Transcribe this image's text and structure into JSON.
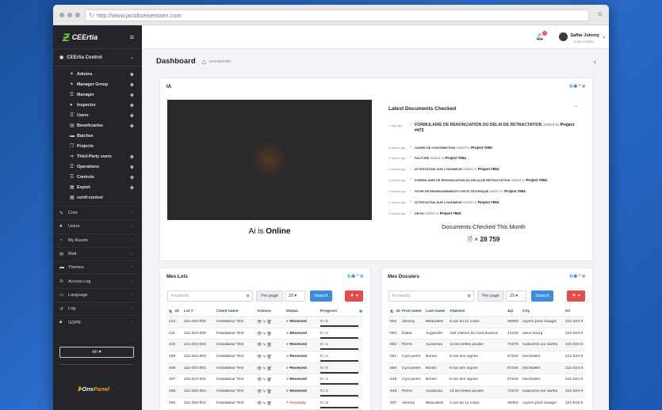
{
  "browser": {
    "url": "http://www.jacobsewensten.com"
  },
  "sidebar": {
    "brand": "CEErtia",
    "section": "CEErtia Control",
    "sub_items": [
      {
        "label": "Admins",
        "icon": "user-shield-icon",
        "plus": true
      },
      {
        "label": "Manager Group",
        "icon": "users-icon",
        "plus": true
      },
      {
        "label": "Manager",
        "icon": "list-icon",
        "plus": true
      },
      {
        "label": "Inspector",
        "icon": "user-icon",
        "plus": true
      },
      {
        "label": "Users",
        "icon": "list-icon",
        "plus": true
      },
      {
        "label": "Beneficiaries",
        "icon": "id-card-icon",
        "plus": true
      },
      {
        "label": "Batches",
        "icon": "folder-icon",
        "plus": false
      },
      {
        "label": "Projects",
        "icon": "copy-icon",
        "plus": false
      },
      {
        "label": "Third-Party users",
        "icon": "arrow-right-icon",
        "plus": true
      },
      {
        "label": "Operations",
        "icon": "list-icon",
        "plus": true
      },
      {
        "label": "Controls",
        "icon": "list-icon",
        "plus": true
      },
      {
        "label": "Export",
        "icon": "calendar-icon",
        "plus": true
      },
      {
        "label": "certif-control",
        "icon": "grid-icon",
        "plus": false
      }
    ],
    "nav": [
      {
        "label": "Core",
        "icon": "wrench-icon"
      },
      {
        "label": "Users",
        "icon": "users-icon"
      },
      {
        "label": "My Assets",
        "icon": "chart-icon"
      },
      {
        "label": "Mail",
        "icon": "mail-icon"
      },
      {
        "label": "Themes",
        "icon": "themes-icon"
      },
      {
        "label": "Access Log",
        "icon": "refresh-icon"
      },
      {
        "label": "Language",
        "icon": "language-icon"
      },
      {
        "label": "Log",
        "icon": "log-icon"
      },
      {
        "label": "GDPR",
        "icon": "lock-icon"
      }
    ],
    "language": "en",
    "footer_brand_prefix": "Ons",
    "footer_brand_suffix": "Panel"
  },
  "topbar": {
    "user_name": "Saffar Johnny",
    "user_role": "Super Admin",
    "notif_count": "1"
  },
  "page": {
    "title": "Dashboard",
    "breadcrumb": "DASHBOARD"
  },
  "ia_card": {
    "title": "IA",
    "status_prefix": "Ai",
    "status_suffix": " is ",
    "status_word": "Online",
    "latest_title": "Latest Documents Checked",
    "timeline": [
      {
        "time": "1 day ago",
        "doc": "FORMULAIRE DE RENONCIATION DU DELAI DE RETRACTATION",
        "mid": " added to ",
        "project": "Project #472"
      },
      {
        "time": "2 weeks ago",
        "doc": "CADRE DE CONTRIBUTION",
        "mid": " added to ",
        "project": "Project #554"
      },
      {
        "time": "2 weeks ago",
        "doc": "FACTURE",
        "mid": " added to ",
        "project": "Project #554"
      },
      {
        "time": "2 weeks ago",
        "doc": "ATTESTATION SUR L'HONNEUR",
        "mid": " added to ",
        "project": "Project #554"
      },
      {
        "time": "2 weeks ago",
        "doc": "FORMULAIRE DE RENONCIATION DU DELAI DE RETRACTATION",
        "mid": " added to ",
        "project": "Project #554"
      },
      {
        "time": "2 weeks ago",
        "doc": "FICHE DE RENSEIGNEMENTS VISITE TECHNIQUE",
        "mid": " added to ",
        "project": "Project #554"
      },
      {
        "time": "2 weeks ago",
        "doc": "ATTESTATION SUR L'HONNEUR",
        "mid": " added to ",
        "project": "Project #553"
      },
      {
        "time": "2 weeks ago",
        "doc": "DEVIS",
        "mid": " added to ",
        "project": "Project #553"
      }
    ],
    "docs_title": "Documents Checked This Month",
    "docs_value": "28 759",
    "docs_prefix": "× "
  },
  "lots": {
    "title": "Mes Lots",
    "keywords_placeholder": "Keywords",
    "per_page_label": "Per page",
    "per_page_value": "20",
    "search_label": "Search",
    "columns": [
      "ID",
      "Lot #",
      "Client name",
      "Actions",
      "Status",
      "Progress"
    ],
    "rows": [
      {
        "id": "212",
        "lot": "221-024-005",
        "client": "Installateur Test",
        "status": "Received",
        "progress": "0 / 2"
      },
      {
        "id": "211",
        "lot": "221-024-005",
        "client": "Installateur Test",
        "status": "Received",
        "progress": "0 / 1"
      },
      {
        "id": "210",
        "lot": "221-024-004",
        "client": "Installateur Test",
        "status": "Received",
        "progress": "0 / 1"
      },
      {
        "id": "209",
        "lot": "221-024-003",
        "client": "Installateur Test",
        "status": "Received",
        "progress": "0 / 1"
      },
      {
        "id": "208",
        "lot": "221-024-002",
        "client": "Installateur Test",
        "status": "Received",
        "progress": "0 / 0"
      },
      {
        "id": "207",
        "lot": "221-024-001",
        "client": "Installateur Test",
        "status": "Received",
        "progress": "0 / 1"
      },
      {
        "id": "206",
        "lot": "221-020-002",
        "client": "Installateur Test",
        "status": "Received",
        "progress": "0 / 2"
      },
      {
        "id": "205",
        "lot": "221-020-001",
        "client": "Installateur Test",
        "status": "Anomaly",
        "progress": "0 / 3"
      }
    ]
  },
  "dossiers": {
    "title": "Mes Dossiers",
    "keywords_placeholder": "Keywords",
    "per_page_label": "Per page",
    "per_page_value": "20",
    "search_label": "Search",
    "columns": [
      "ID",
      "First name",
      "Last name",
      "Address",
      "Zip",
      "City",
      "lot"
    ],
    "rows": [
      {
        "id": "554",
        "first": "Jeremy",
        "last": "Billaudelle",
        "address": "4 rue du 11 corps",
        "zip": "06350",
        "city": "noyers pont maugis",
        "lot": "221-024-0"
      },
      {
        "id": "553",
        "first": "Didier",
        "last": "Augendre",
        "address": "146 chemin du rond buisson",
        "zip": "14100",
        "city": "vieux bourg",
        "lot": "221-024-0"
      },
      {
        "id": "552",
        "first": "Pierre",
        "last": "Audureau",
        "address": "13 les belles poules",
        "zip": "72270",
        "city": "malicorne sur sarthe",
        "lot": "221-024-0"
      },
      {
        "id": "551",
        "first": "Cyril pierre",
        "last": "Bories",
        "address": "8 rue des vignes",
        "zip": "67240",
        "city": "bischwiller",
        "lot": "221-024-0"
      },
      {
        "id": "550",
        "first": "Cyril pierre",
        "last": "Bories",
        "address": "8 rue des vignes",
        "zip": "67240",
        "city": "bischwiller",
        "lot": "221-024-0"
      },
      {
        "id": "549",
        "first": "Cyril pierre",
        "last": "Bories",
        "address": "8 rue des vignes",
        "zip": "67240",
        "city": "bischwiller",
        "lot": "221-024-0"
      },
      {
        "id": "548",
        "first": "Pierre",
        "last": "Audureau",
        "address": "13 les belles poules",
        "zip": "72270",
        "city": "malicorne sur sarthe",
        "lot": "221-024-0"
      },
      {
        "id": "537",
        "first": "Jeremy",
        "last": "Billaudelle",
        "address": "4 rue du 11 corps",
        "zip": "06350",
        "city": "noyers pont maugis",
        "lot": "221-919-0"
      }
    ]
  }
}
